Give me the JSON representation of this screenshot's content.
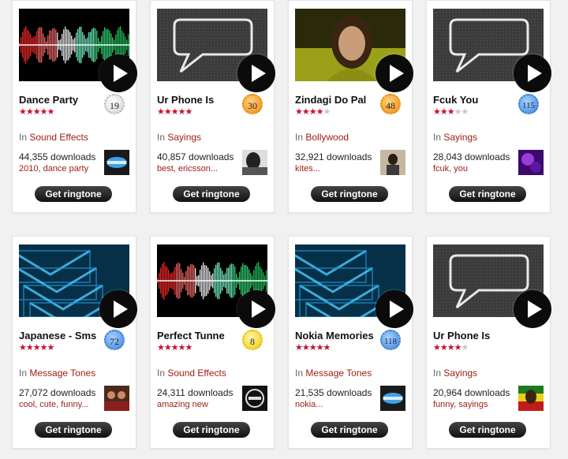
{
  "download_suffix": "downloads",
  "category_prefix": "In",
  "button_label": "Get ringtone",
  "star_glyph": "★",
  "items": [
    {
      "title": "Dance Party",
      "rating": 5,
      "rank": "19",
      "badge_color": "gray",
      "category": "Sound Effects",
      "downloads": "44,355",
      "tags": "2010, dance party",
      "thumb": "waveform",
      "mini": "speaker-logo"
    },
    {
      "title": "Ur Phone Is",
      "rating": 5,
      "rank": "30",
      "badge_color": "orange",
      "category": "Sayings",
      "downloads": "40,857",
      "tags": "best, ericsson...",
      "thumb": "speech-bubble",
      "mini": "bw-photo"
    },
    {
      "title": "Zindagi Do Pal",
      "rating": 4,
      "rank": "48",
      "badge_color": "orange",
      "category": "Bollywood",
      "downloads": "32,921",
      "tags": "kites...",
      "thumb": "portrait",
      "mini": "portrait-small"
    },
    {
      "title": "Fcuk You",
      "rating": 3,
      "rank": "115",
      "badge_color": "blue",
      "category": "Sayings",
      "downloads": "28,043",
      "tags": "fcuk, you",
      "thumb": "speech-bubble",
      "mini": "purple-art"
    },
    {
      "title": "Japanese - Sms",
      "rating": 5,
      "rank": "72",
      "badge_color": "blue",
      "category": "Message Tones",
      "downloads": "27,072",
      "tags": "cool, cute, funny...",
      "thumb": "envelopes",
      "mini": "group-photo"
    },
    {
      "title": "Perfect Tunne",
      "rating": 5,
      "rank": "8",
      "badge_color": "yellow",
      "category": "Sound Effects",
      "downloads": "24,311",
      "tags": "amazing new",
      "thumb": "waveform",
      "mini": "dark-logo"
    },
    {
      "title": "Nokia Memories",
      "rating": 5,
      "rank": "118",
      "badge_color": "blue",
      "category": "Message Tones",
      "downloads": "21,535",
      "tags": "nokia...",
      "thumb": "envelopes",
      "mini": "speaker-logo"
    },
    {
      "title": "Ur Phone Is",
      "rating": 4,
      "rank": "",
      "badge_color": "none",
      "category": "Sayings",
      "downloads": "20,964",
      "tags": "funny, sayings",
      "thumb": "speech-bubble",
      "mini": "reggae-photo"
    }
  ]
}
